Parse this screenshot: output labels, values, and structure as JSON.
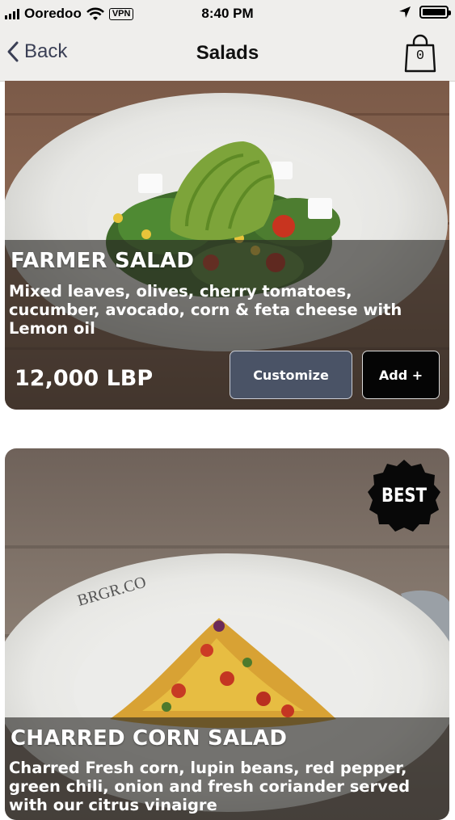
{
  "status_bar": {
    "carrier": "Ooredoo",
    "vpn": "VPN",
    "time": "8:40 PM"
  },
  "nav": {
    "back_label": "Back",
    "title": "Salads",
    "cart_count": "0"
  },
  "items": [
    {
      "name": "FARMER SALAD",
      "description": "Mixed leaves, olives, cherry tomatoes, cucumber, avocado, corn & feta cheese with Lemon oil",
      "price": "12,000 LBP",
      "customize_label": "Customize",
      "add_label": "Add +"
    },
    {
      "name": "CHARRED CORN SALAD",
      "description": "Charred Fresh corn, lupin beans, red pepper, green chili, onion and fresh coriander served with our citrus vinaigre",
      "badge": "BEST",
      "plate_brand": "BRGR.CO"
    }
  ],
  "colors": {
    "customize_button": "#4a5366",
    "add_button": "#050505",
    "nav_background": "#efeeec",
    "back_tint": "#3a3f55"
  }
}
